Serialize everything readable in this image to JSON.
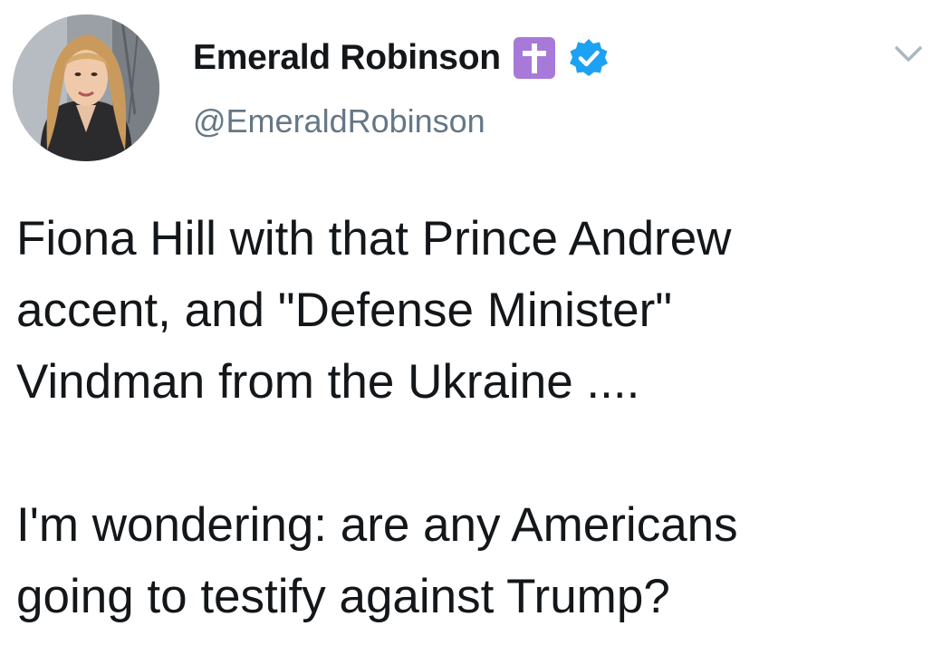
{
  "author": {
    "display_name": "Emerald Robinson",
    "handle": "@EmeraldRobinson",
    "emoji_icon": "latin-cross-icon",
    "verified_icon": "verified-badge-icon"
  },
  "menu": {
    "icon": "chevron-down-icon"
  },
  "tweet": {
    "paragraph1": {
      "line1": "Fiona Hill with that Prince Andrew",
      "line2": "accent, and \"Defense Minister\"",
      "line3": "Vindman from the Ukraine ...."
    },
    "paragraph2": {
      "line1": "I'm wondering: are any Americans",
      "line2": "going to testify against Trump?"
    }
  },
  "colors": {
    "text": "#14171a",
    "secondary_text": "#657786",
    "verified": "#1da1f2",
    "emoji_background": "#a779d8",
    "chevron": "#aab8c2"
  }
}
